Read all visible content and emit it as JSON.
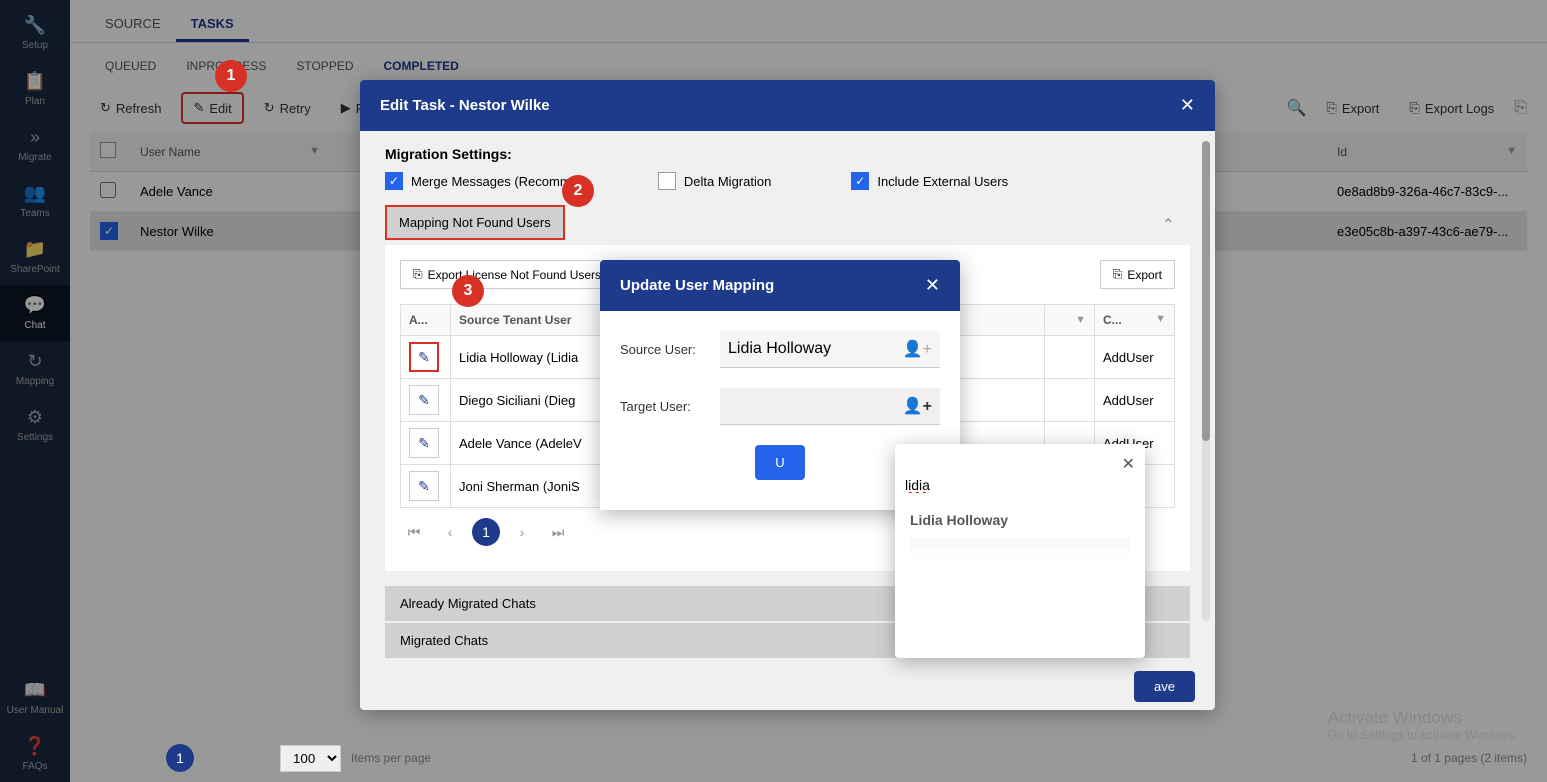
{
  "sidebar": {
    "items": [
      {
        "label": "Setup",
        "icon": "🔧"
      },
      {
        "label": "Plan",
        "icon": "📋"
      },
      {
        "label": "Migrate",
        "icon": "»"
      },
      {
        "label": "Teams",
        "icon": "👥"
      },
      {
        "label": "SharePoint",
        "icon": "📁"
      },
      {
        "label": "Chat",
        "icon": "💬"
      },
      {
        "label": "Mapping",
        "icon": "↻"
      },
      {
        "label": "Settings",
        "icon": "⚙"
      }
    ],
    "bottom": [
      {
        "label": "User Manual",
        "icon": "📖"
      },
      {
        "label": "FAQs",
        "icon": "❓"
      }
    ]
  },
  "tabs_primary": [
    {
      "label": "SOURCE",
      "active": false
    },
    {
      "label": "TASKS",
      "active": true
    }
  ],
  "tabs_secondary": [
    {
      "label": "QUEUED",
      "active": false
    },
    {
      "label": "INPROGRESS",
      "active": false
    },
    {
      "label": "STOPPED",
      "active": false
    },
    {
      "label": "COMPLETED",
      "active": true
    }
  ],
  "toolbar": {
    "refresh": "Refresh",
    "edit": "Edit",
    "retry": "Retry",
    "rerun": "Rerun",
    "export": "Export",
    "export_logs": "Export Logs"
  },
  "table": {
    "headers": {
      "username": "User Name",
      "id": "Id"
    },
    "rows": [
      {
        "checked": false,
        "username": "Adele Vance",
        "id": "0e8ad8b9-326a-46c7-83c9-..."
      },
      {
        "checked": true,
        "username": "Nestor Wilke",
        "id": "e3e05c8b-a397-43c6-ae79-..."
      }
    ]
  },
  "modal_edit": {
    "title": "Edit Task - Nestor Wilke",
    "section_title": "Migration Settings:",
    "merge_label": "Merge Messages (Recomme",
    "delta_label": "Delta Migration",
    "external_label": "Include External Users",
    "accordion1": "Mapping Not Found Users",
    "export_license": "Export License Not Found Users",
    "export": "Export",
    "inner_headers": {
      "action": "A...",
      "source": "Source Tenant User",
      "c": "C..."
    },
    "inner_rows": [
      {
        "source": "Lidia Holloway (Lidia",
        "c": "AddUser"
      },
      {
        "source": "Diego Siciliani (Dieg",
        "c": "AddUser"
      },
      {
        "source": "Adele Vance (AdeleV",
        "c": "AddUser"
      },
      {
        "source": "Joni Sherman (JoniS",
        "c": ""
      }
    ],
    "accordion2": "Already Migrated Chats",
    "accordion3": "Migrated Chats",
    "save": "Save"
  },
  "modal_update": {
    "title": "Update User Mapping",
    "source_label": "Source User:",
    "source_value": "Lidia Holloway",
    "target_label": "Target User:",
    "update_btn": "U"
  },
  "dropdown": {
    "search": "lidia",
    "item": "Lidia Holloway"
  },
  "footer": {
    "page_size": "100",
    "items_label": "Items per page",
    "summary": "1 of 1 pages (2 items)"
  },
  "watermark": {
    "title": "Activate Windows",
    "sub": "Go to Settings to activate Windows."
  },
  "callouts": [
    "1",
    "2",
    "3"
  ]
}
